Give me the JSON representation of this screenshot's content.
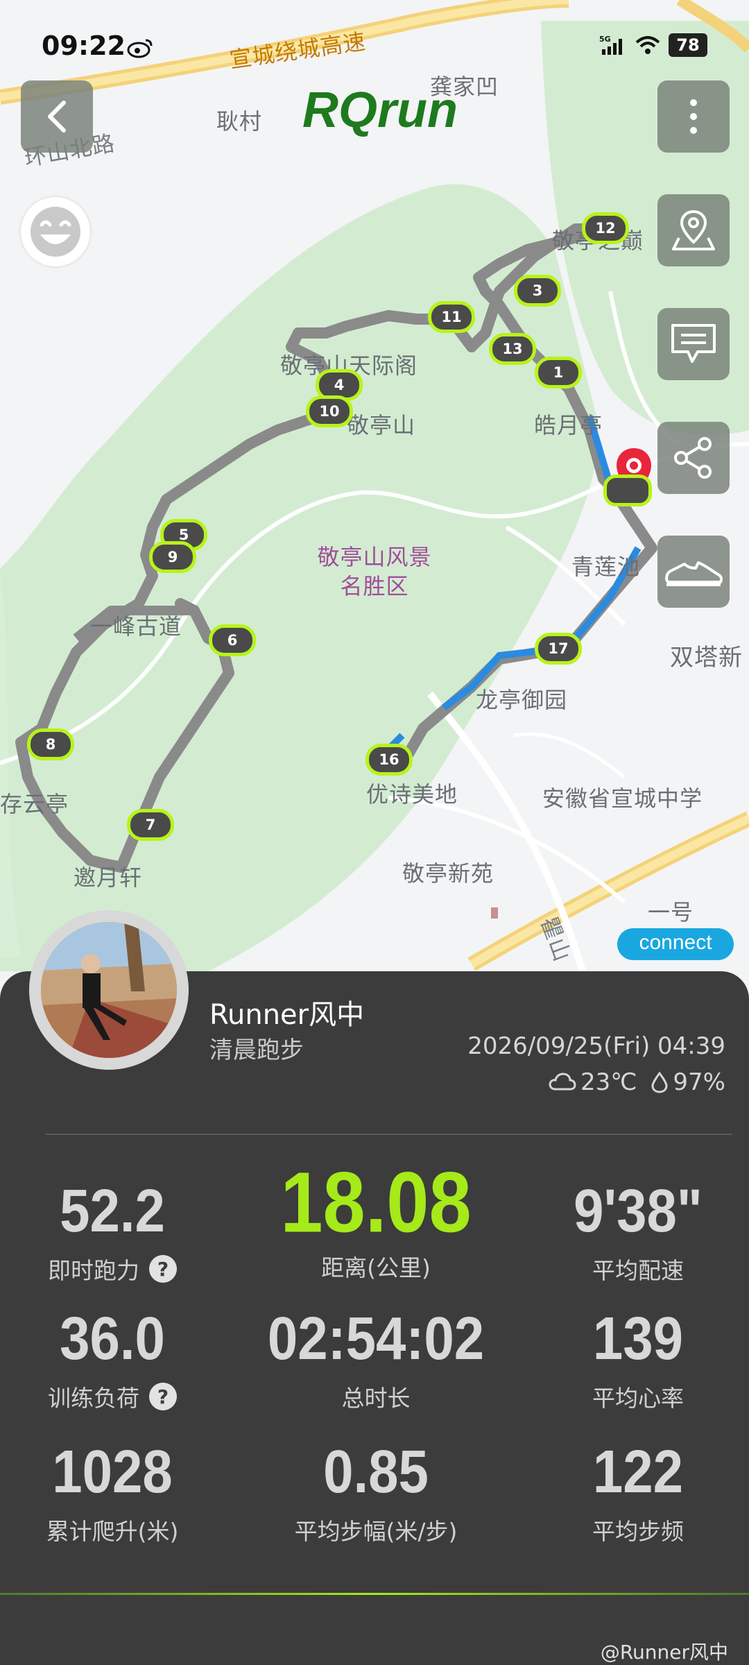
{
  "status_bar": {
    "time": "09:22",
    "battery": "78"
  },
  "app": {
    "brand": "RQrun"
  },
  "map": {
    "labels": {
      "expressway": "宣城绕城高速",
      "gongjiaao": "龚家凹",
      "gengcun": "耿村",
      "huanshan_road": "环山北路",
      "jingting_peak": "敬亭之巅",
      "jingting_pavilion": "敬亭山天际阁",
      "jingting_mountain": "敬亭山",
      "haoyue": "皓月亭",
      "scenic_area": "敬亭山风景名胜区",
      "qinglian": "青莲池",
      "shuangta": "双塔新",
      "yifeng": "一峰古道",
      "longting": "龙亭御园",
      "youshi": "优诗美地",
      "anhui_school": "安徽省宣城中学",
      "cunyun": "存云亭",
      "yaoyue": "邀月轩",
      "jingting_xinyuan": "敬亭新苑",
      "yihao": "一号",
      "qushan": "瞿山"
    },
    "markers": [
      "1",
      "3",
      "4",
      "5",
      "6",
      "7",
      "8",
      "9",
      "10",
      "11",
      "12",
      "13",
      "16",
      "17"
    ]
  },
  "summary": {
    "username": "Runner风中",
    "activity": "清晨跑步",
    "datetime": "2026/09/25(Fri) 04:39",
    "temperature": "23℃",
    "humidity": "97%"
  },
  "stats": [
    {
      "value": "52.2",
      "label": "即时跑力",
      "help": "?"
    },
    {
      "value": "18.08",
      "label": "距离(公里)"
    },
    {
      "value": "9'38\"",
      "label": "平均配速"
    },
    {
      "value": "36.0",
      "label": "训练负荷",
      "help": "?"
    },
    {
      "value": "02:54:02",
      "label": "总时长"
    },
    {
      "value": "139",
      "label": "平均心率"
    },
    {
      "value": "1028",
      "label": "累计爬升(米)"
    },
    {
      "value": "0.85",
      "label": "平均步幅(米/步)"
    },
    {
      "value": "122",
      "label": "平均步频"
    }
  ],
  "badges": {
    "connect": "connect"
  },
  "watermark": "@Runner风中",
  "colors": {
    "accent": "#a6ea1a",
    "route": "#8a8a8a",
    "route_blue": "#2a8be0",
    "pin": "#e8253b"
  }
}
